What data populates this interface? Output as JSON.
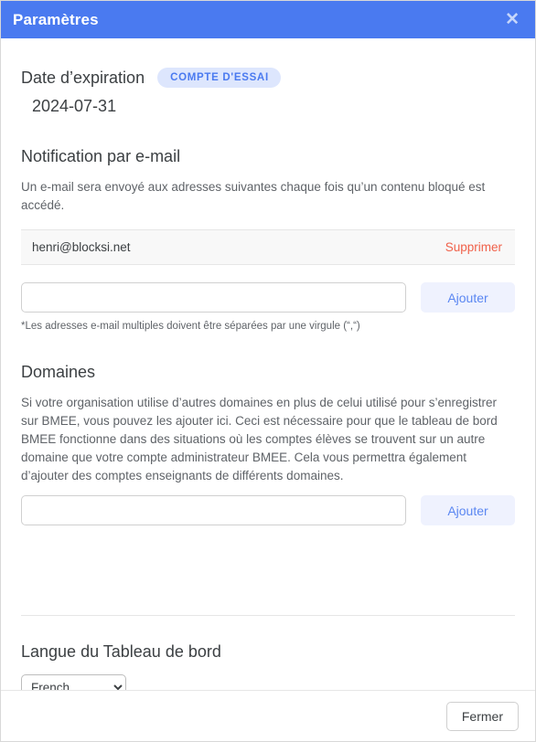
{
  "header": {
    "title": "Paramètres",
    "close_icon": "close-icon",
    "bar_color": "#4a7af0"
  },
  "expiration": {
    "label": "Date d’expiration",
    "badge": "COMPTE D'ESSAI",
    "badge_bg": "#dde6fd",
    "badge_color": "#4a7af0",
    "date": "2024-07-31"
  },
  "notification": {
    "title": "Notification par e-mail",
    "description": "Un e-mail sera envoyé aux adresses suivantes chaque fois qu’un contenu bloqué est accédé.",
    "emails": [
      {
        "address": "henri@blocksi.net",
        "remove_label": "Supprimer"
      }
    ],
    "remove_color": "#f0614a",
    "input_value": "",
    "input_placeholder": "",
    "add_label": "Ajouter",
    "footnote": "*Les adresses e-mail multiples doivent être séparées par une virgule (“,“)"
  },
  "domains": {
    "title": "Domaines",
    "description": "Si votre organisation utilise d’autres domaines en plus de celui utilisé pour s’enregistrer sur BMEE, vous pouvez les ajouter ici. Ceci est nécessaire pour que le tableau de bord BMEE fonctionne dans des situations où les comptes élèves se trouvent sur un autre domaine que votre compte administrateur BMEE. Cela vous permettra également d’ajouter des comptes enseignants de différents domaines.",
    "input_value": "",
    "input_placeholder": "",
    "add_label": "Ajouter"
  },
  "language": {
    "title": "Langue du Tableau de bord",
    "selected": "French",
    "options": [
      "French"
    ],
    "chevron_icon": "chevron-down-icon"
  },
  "footer": {
    "close_label": "Fermer"
  }
}
